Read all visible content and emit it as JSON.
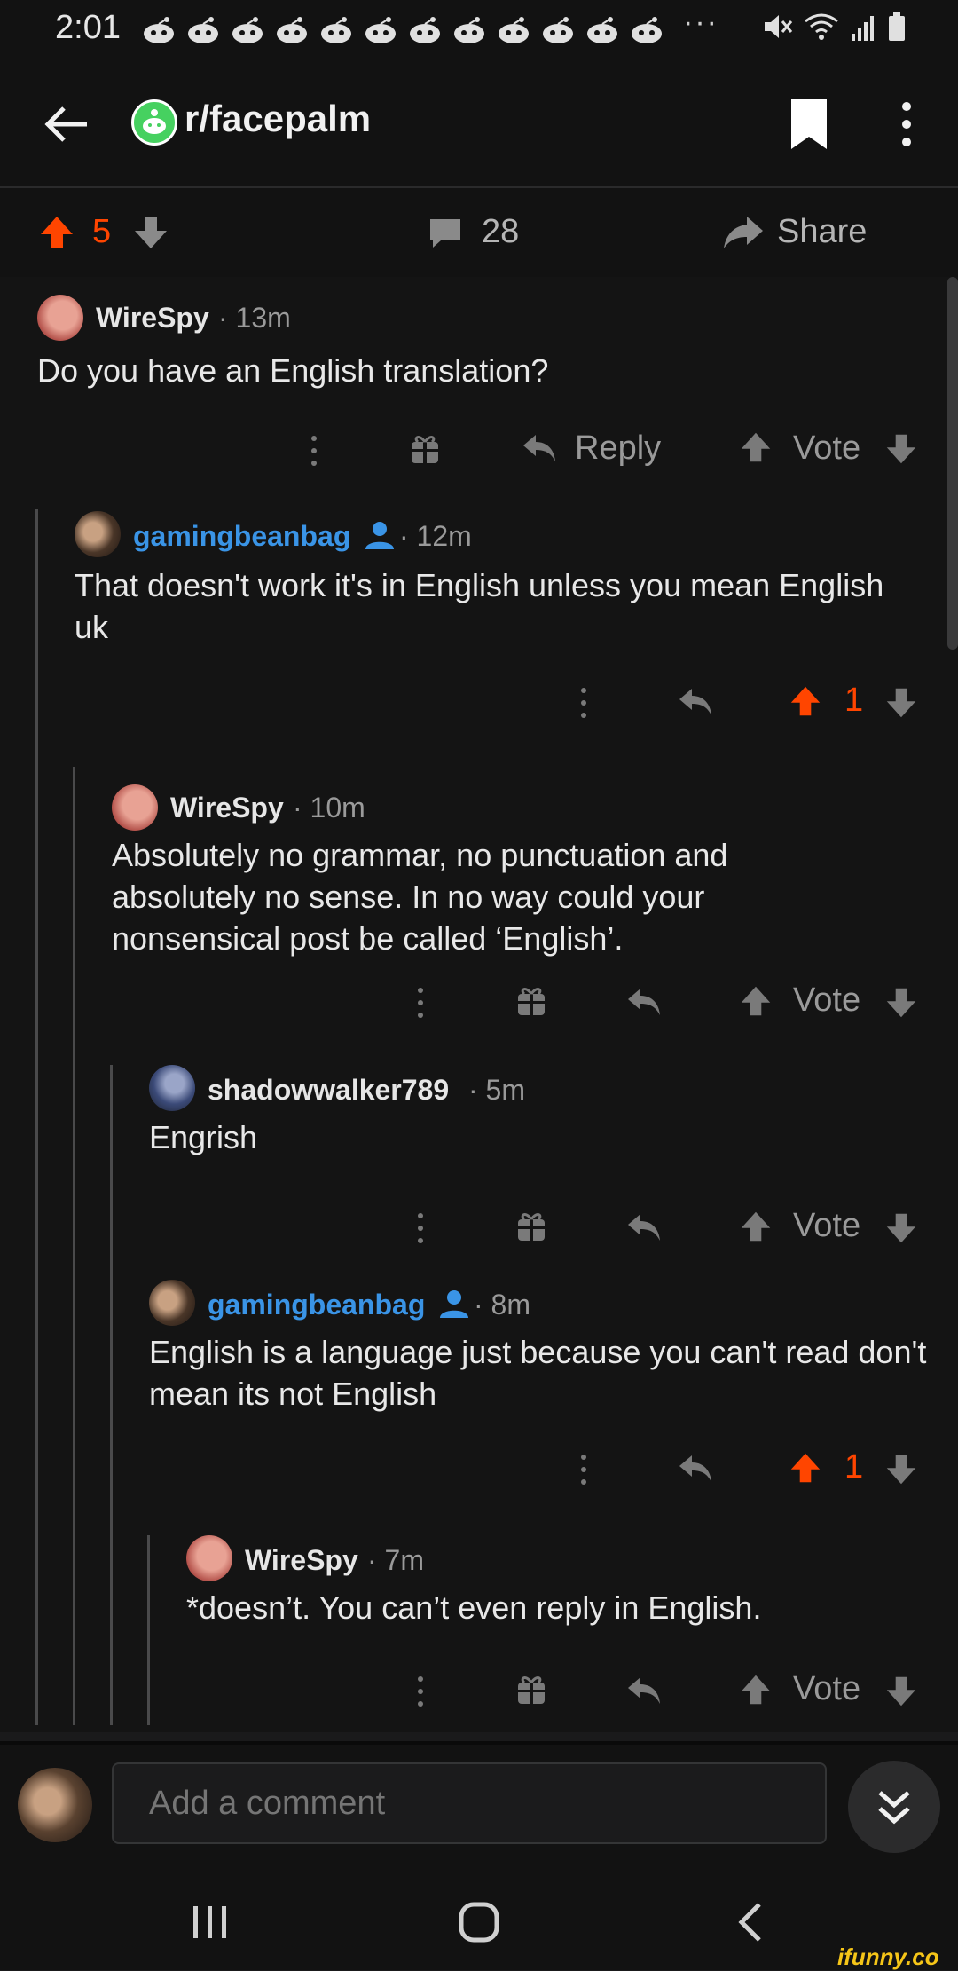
{
  "status_bar": {
    "time": "2:01",
    "more": "···"
  },
  "header": {
    "subreddit": "r/facepalm"
  },
  "post_actions": {
    "score": "5",
    "comments": "28",
    "share_label": "Share"
  },
  "comments": [
    {
      "user": "WireSpy",
      "time": "· 13m",
      "body": "Do you have an English translation?",
      "reply_label": "Reply",
      "vote_label": "Vote"
    },
    {
      "user": "gamingbeanbag",
      "time": "· 12m",
      "body": "That doesn't work it's in English unless you mean English uk",
      "score": "1"
    },
    {
      "user": "WireSpy",
      "time": "· 10m",
      "body": "Absolutely no grammar, no punctuation and absolutely no sense. In no way could your nonsensical post be called ‘English’.",
      "vote_label": "Vote"
    },
    {
      "user": "shadowwalker789",
      "time": "· 5m",
      "body": "Engrish",
      "vote_label": "Vote"
    },
    {
      "user": "gamingbeanbag",
      "time": "· 8m",
      "body": "English is a language just because you can't read don't mean its not English",
      "score": "1"
    },
    {
      "user": "WireSpy",
      "time": "· 7m",
      "body": "*doesn’t. You can’t even reply in English.",
      "vote_label": "Vote"
    }
  ],
  "comment_box": {
    "placeholder": "Add a comment"
  },
  "watermark": "ifunny.co",
  "colors": {
    "upvote": "#ff4500",
    "op_blue": "#3a94e6",
    "background": "#141414"
  }
}
